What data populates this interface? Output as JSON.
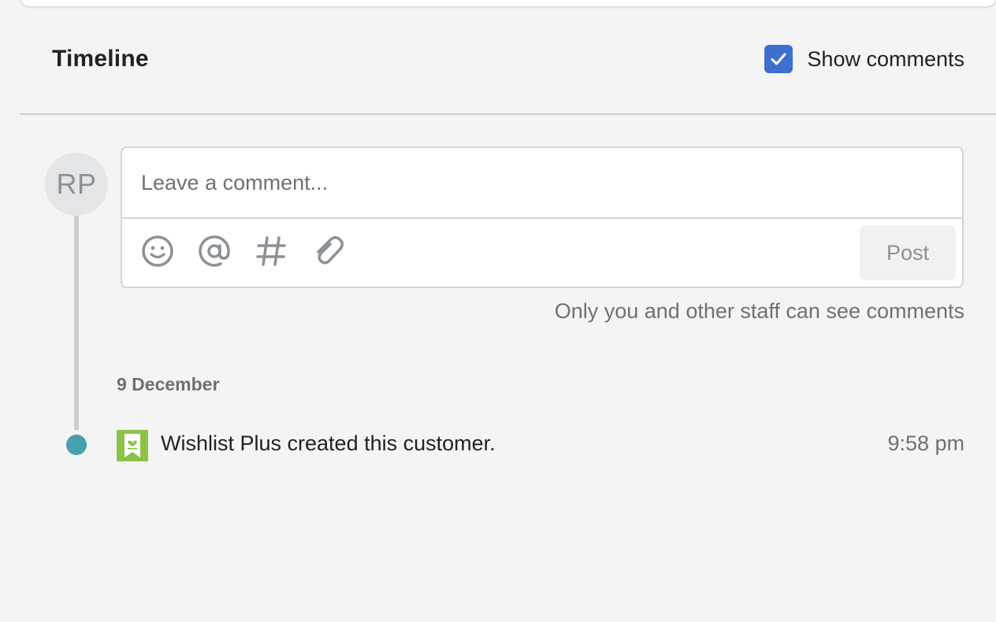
{
  "header": {
    "title": "Timeline",
    "show_comments_label": "Show comments",
    "show_comments_checked": true
  },
  "avatar": {
    "initials": "RP"
  },
  "comment": {
    "placeholder": "Leave a comment...",
    "post_label": "Post",
    "toolbar_icons": [
      "emoji-icon",
      "mention-icon",
      "hashtag-icon",
      "attachment-icon"
    ],
    "helper_text": "Only you and other staff can see comments"
  },
  "events": [
    {
      "date": "9 December",
      "app_icon": "wishlist-plus-app-icon",
      "text": "Wishlist Plus created this customer.",
      "time": "9:58 pm"
    }
  ],
  "colors": {
    "checkbox": "#3d6fcd",
    "event_dot": "#47a1ad",
    "app_icon": "#8bc34a"
  }
}
